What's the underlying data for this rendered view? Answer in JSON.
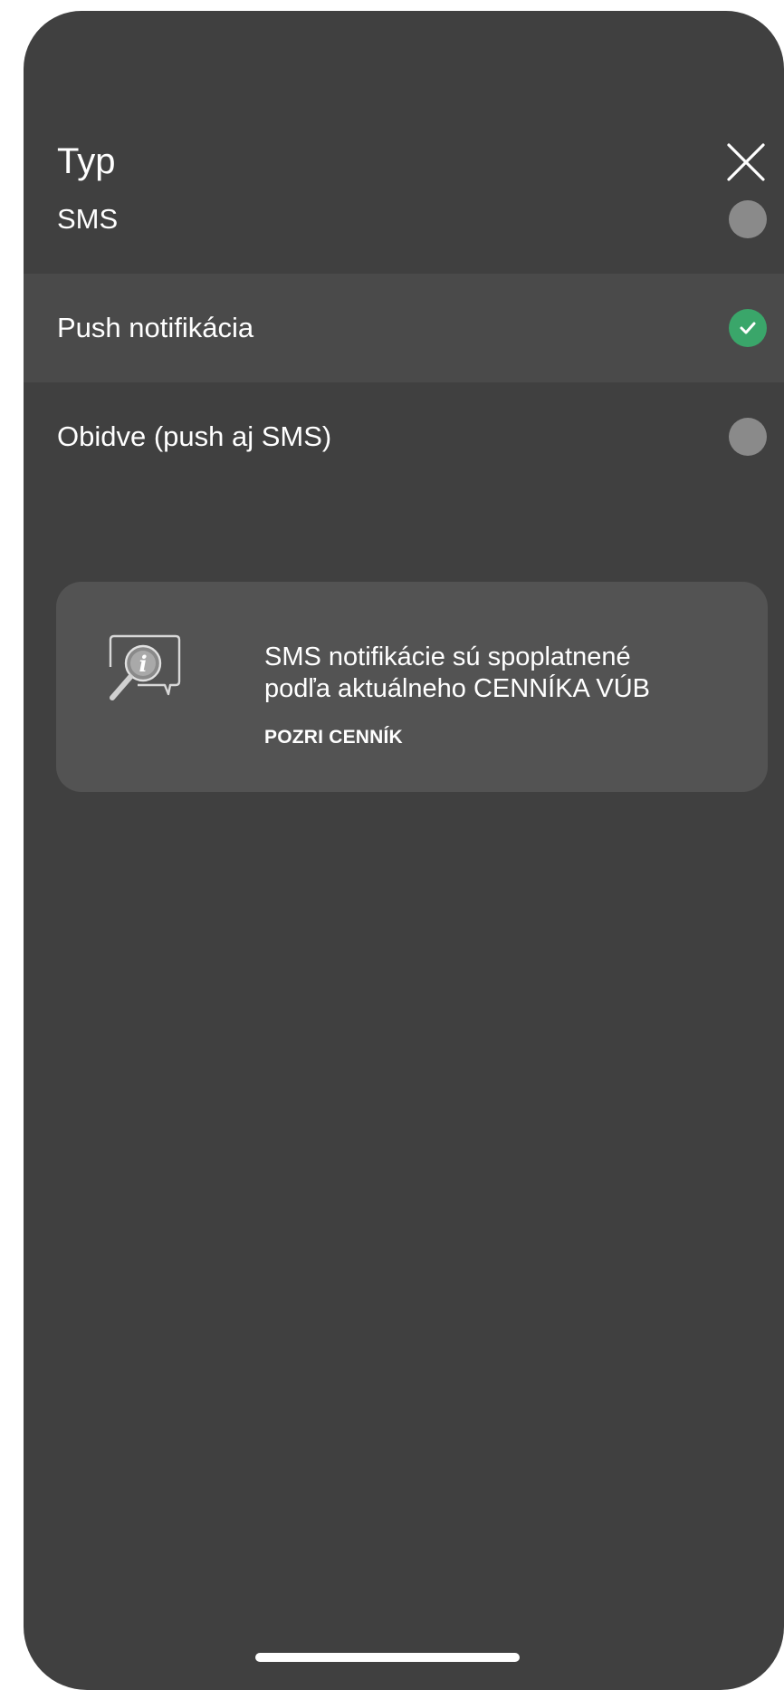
{
  "sheet": {
    "title": "Typ",
    "close_icon": "close-icon"
  },
  "options": [
    {
      "label": "SMS",
      "selected": false
    },
    {
      "label": "Push notifikácia",
      "selected": true
    },
    {
      "label": "Obidve (push aj SMS)",
      "selected": false
    }
  ],
  "info": {
    "icon": "info-magnifier-icon",
    "line1": "SMS notifikácie sú spoplatnené",
    "line2": "podľa aktuálneho CENNÍKA VÚB",
    "link_label": "POZRI CENNÍK"
  },
  "colors": {
    "sheet_bg": "#404040",
    "selected_row_bg": "#4a4a4a",
    "radio_unchecked": "#8a8a8a",
    "radio_checked": "#3aa66a",
    "card_bg": "#535353"
  }
}
